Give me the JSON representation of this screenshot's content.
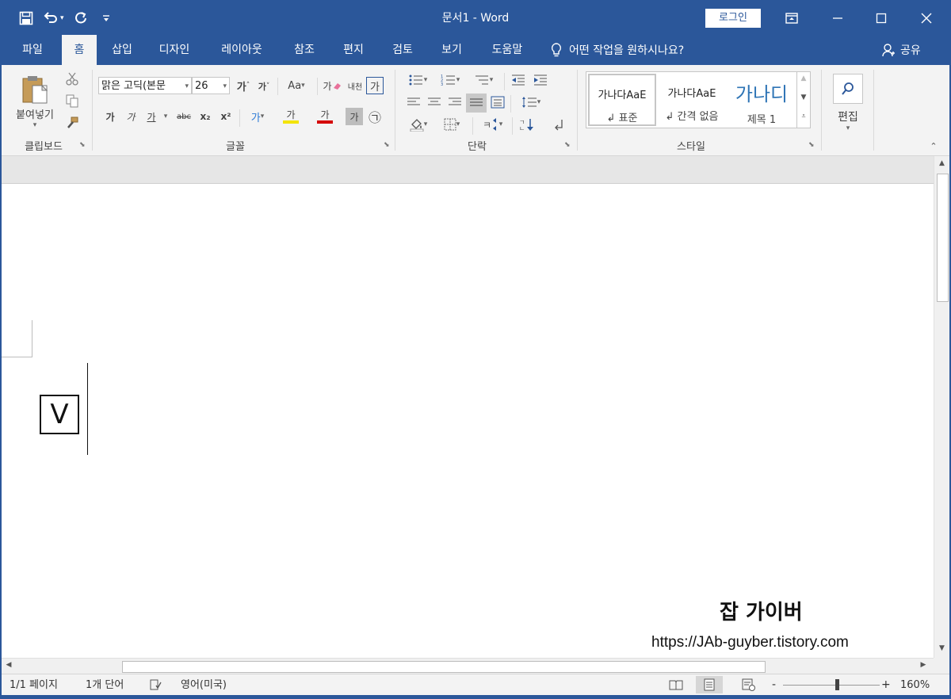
{
  "window": {
    "title": "문서1  -  Word"
  },
  "qat": {
    "save_icon": "floppy-disk",
    "undo_icon": "undo-arrow",
    "redo_icon": "redo-arrow",
    "customize_icon": "customize-caret"
  },
  "titlebar": {
    "login_label": "로그인",
    "ribbon_display_icon": "ribbon-display",
    "minimize_icon": "minimize",
    "maximize_icon": "maximize",
    "close_icon": "close"
  },
  "tabs": [
    {
      "label": "파일"
    },
    {
      "label": "홈"
    },
    {
      "label": "삽입"
    },
    {
      "label": "디자인"
    },
    {
      "label": "레이아웃"
    },
    {
      "label": "참조"
    },
    {
      "label": "편지"
    },
    {
      "label": "검토"
    },
    {
      "label": "보기"
    },
    {
      "label": "도움말"
    }
  ],
  "tellme": {
    "label": "어떤 작업을 원하시나요?"
  },
  "share": {
    "label": "공유"
  },
  "clipboard": {
    "paste_label": "붙여넣기",
    "group_label": "클립보드"
  },
  "font": {
    "font_name": "맑은 고딕(본문",
    "font_size": "26",
    "grow_label": "가",
    "shrink_label": "가",
    "case_label": "Aa",
    "clear_label": "가",
    "phonetic_label": "내천",
    "border_char_label": "가",
    "bold_label": "가",
    "italic_label": "가",
    "underline_label": "가",
    "strike_label": "abc",
    "subscript_label": "x₂",
    "superscript_label": "x²",
    "effects_label": "가",
    "highlight_label": "가",
    "font_color_label": "가",
    "shading_label": "가",
    "enclose_label": "㉠",
    "group_label": "글꼴",
    "highlight_color": "#f3e400",
    "font_color": "#d40000"
  },
  "paragraph": {
    "group_label": "단락"
  },
  "styles": {
    "items": [
      {
        "preview": "가나다AaE",
        "name": "↲ 표준"
      },
      {
        "preview": "가나다AaE",
        "name": "↲ 간격 없음"
      },
      {
        "preview": "가나디",
        "name": "제목 1"
      }
    ],
    "group_label": "스타일"
  },
  "editing": {
    "label": "편집"
  },
  "document": {
    "checkbox_glyph": "V",
    "watermark_title": "잡 가이버",
    "watermark_url": "https://JAb-guyber.tistory.com"
  },
  "status": {
    "page": "1/1 페이지",
    "words": "1개 단어",
    "language": "영어(미국)",
    "zoom_minus": "-",
    "zoom_plus": "+",
    "zoom_pct": "160%",
    "zoom_level": 160
  },
  "colors": {
    "accent": "#2b579a",
    "ribbon_bg": "#f3f3f3",
    "tab_active_text": "#2b579a"
  }
}
